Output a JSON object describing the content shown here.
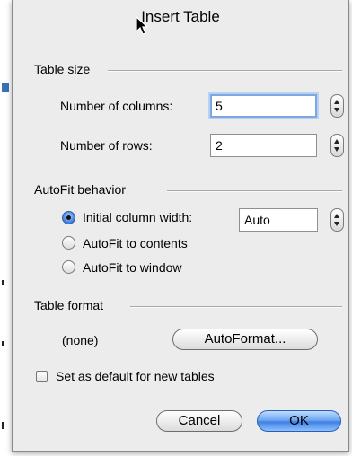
{
  "dialog": {
    "title": "Insert Table",
    "table_size": {
      "heading": "Table size",
      "columns_label": "Number of columns:",
      "columns_value": "5",
      "rows_label": "Number of rows:",
      "rows_value": "2"
    },
    "autofit": {
      "heading": "AutoFit behavior",
      "options": [
        {
          "label": "Initial column width:",
          "selected": true
        },
        {
          "label": "AutoFit to contents",
          "selected": false
        },
        {
          "label": "AutoFit to window",
          "selected": false
        }
      ],
      "column_width_value": "Auto"
    },
    "table_format": {
      "heading": "Table format",
      "current": "(none)",
      "autoformat_button": "AutoFormat..."
    },
    "default_checkbox": {
      "label": "Set as default for new tables",
      "checked": false
    },
    "cancel_button": "Cancel",
    "ok_button": "OK"
  },
  "colors": {
    "dialog_bg": "#ececec",
    "focus_ring": "#7ea6e0",
    "default_button": "#3e80e6"
  }
}
